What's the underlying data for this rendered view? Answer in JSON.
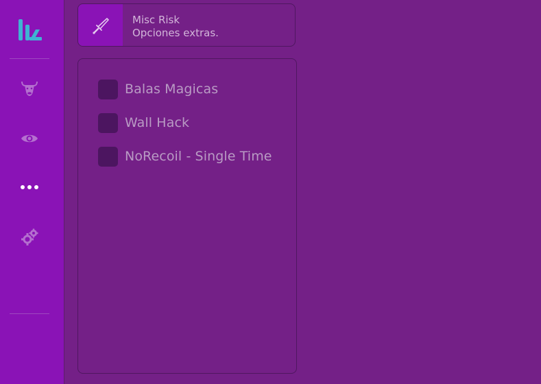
{
  "sidebar": {
    "items": [
      {
        "name": "bull-icon",
        "active": false
      },
      {
        "name": "eye-icon",
        "active": false
      },
      {
        "name": "more-dots-icon",
        "active": true
      },
      {
        "name": "gears-icon",
        "active": false
      }
    ],
    "logo_icon": "logo-icon",
    "colors": {
      "background": "#8a13b6",
      "icon": "#b470cf",
      "active_icon": "#ffffff",
      "logo": "#3fb3d3"
    }
  },
  "header": {
    "icon": "sword-icon",
    "title": "Misc Risk",
    "subtitle": "Opciones extras."
  },
  "options": [
    {
      "label": "Balas Magicas",
      "checked": false
    },
    {
      "label": "Wall Hack",
      "checked": false
    },
    {
      "label": "NoRecoil - Single Time",
      "checked": false
    }
  ],
  "colors": {
    "page_background": "#742087",
    "panel_border": "#4f1760",
    "checkbox": "#4c1560",
    "text": "#b99bc4"
  }
}
